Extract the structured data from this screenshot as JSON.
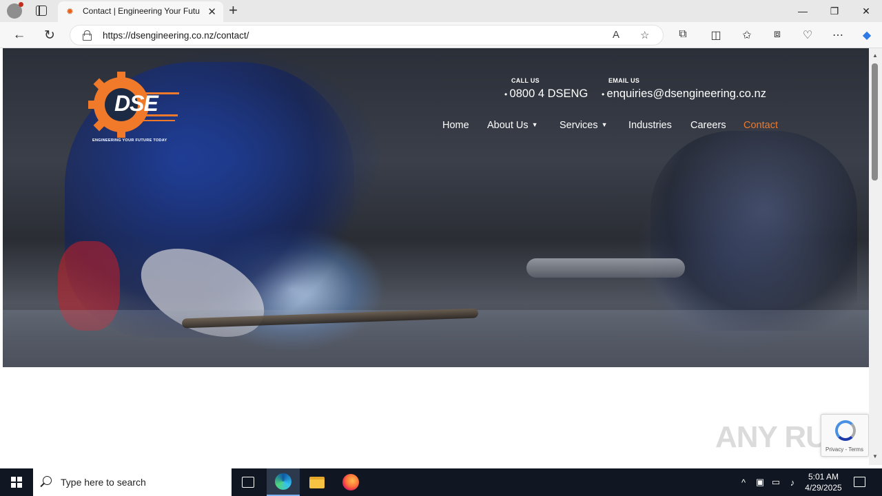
{
  "browser": {
    "tab_title": "Contact | Engineering Your Futur",
    "tab_close": "✕",
    "new_tab": "+",
    "url": "https://dsengineering.co.nz/contact/",
    "window_controls": {
      "minimize": "—",
      "restore": "❐",
      "close": "✕"
    }
  },
  "site": {
    "logo_text": "DSE",
    "logo_tagline": "ENGINEERING YOUR FUTURE TODAY",
    "call_label": "CALL US",
    "call_value": "0800 4 DSENG",
    "email_label": "EMAIL US",
    "email_value": "enquiries@dsengineering.co.nz",
    "menu": [
      {
        "label": "Home",
        "has_dropdown": false,
        "active": false
      },
      {
        "label": "About Us",
        "has_dropdown": true,
        "active": false
      },
      {
        "label": "Services",
        "has_dropdown": true,
        "active": false
      },
      {
        "label": "Industries",
        "has_dropdown": false,
        "active": false
      },
      {
        "label": "Careers",
        "has_dropdown": false,
        "active": false
      },
      {
        "label": "Contact",
        "has_dropdown": false,
        "active": true
      }
    ],
    "accent_color": "#f0792a",
    "recaptcha_text": "Privacy - Terms",
    "watermark": "ANY RUN"
  },
  "taskbar": {
    "search_placeholder": "Type here to search",
    "time": "5:01 AM",
    "date": "4/29/2025"
  }
}
